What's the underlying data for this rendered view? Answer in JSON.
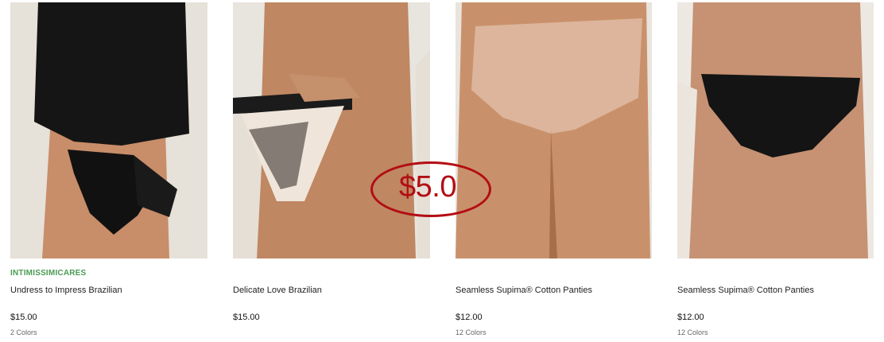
{
  "products": [
    {
      "brand": "INTIMISSIMICARES",
      "name": "Undress to Impress Brazilian",
      "price": "$15.00",
      "colors": "2 Colors",
      "image_icon": "lingerie-photo-icon"
    },
    {
      "brand": "",
      "name": "Delicate Love Brazilian",
      "price": "$15.00",
      "colors": "",
      "image_icon": "lingerie-photo-icon"
    },
    {
      "brand": "",
      "name": "Seamless Supima® Cotton Panties",
      "price": "$12.00",
      "colors": "12 Colors",
      "image_icon": "lingerie-photo-icon"
    },
    {
      "brand": "",
      "name": "Seamless Supima® Cotton Panties",
      "price": "$12.00",
      "colors": "12 Colors",
      "image_icon": "lingerie-photo-icon"
    }
  ],
  "promo": {
    "text": "$5.0",
    "color": "#b30d14"
  },
  "colors": {
    "brand_green": "#4a9a54"
  }
}
